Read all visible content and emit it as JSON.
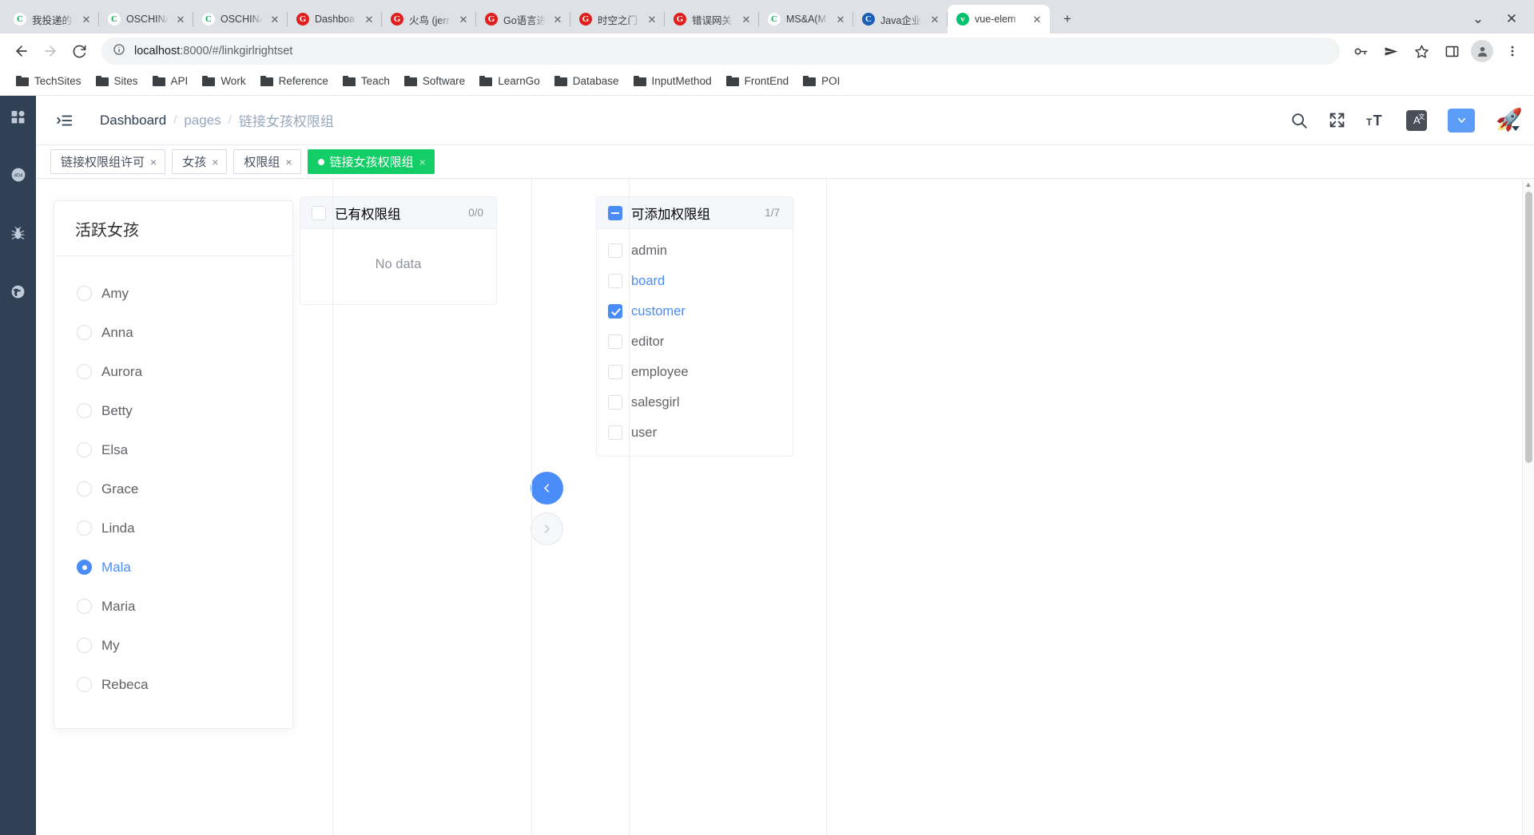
{
  "browser": {
    "tabs": [
      {
        "title": "我投递的",
        "favicon_letter": "C",
        "favicon_color": "#00b04f",
        "favicon_bg": "#ffffff",
        "active": false
      },
      {
        "title": "OSCHINA",
        "favicon_letter": "C",
        "favicon_color": "#00b04f",
        "favicon_bg": "#ffffff",
        "active": false
      },
      {
        "title": "OSCHINA",
        "favicon_letter": "C",
        "favicon_color": "#00b04f",
        "favicon_bg": "#ffffff",
        "active": false
      },
      {
        "title": "Dashboa",
        "favicon_letter": "G",
        "favicon_color": "#ffffff",
        "favicon_bg": "#e01e1e",
        "active": false
      },
      {
        "title": "火鸟 (jerr",
        "favicon_letter": "G",
        "favicon_color": "#ffffff",
        "favicon_bg": "#e01e1e",
        "active": false
      },
      {
        "title": "Go语言进",
        "favicon_letter": "G",
        "favicon_color": "#ffffff",
        "favicon_bg": "#e01e1e",
        "active": false
      },
      {
        "title": "时空之门",
        "favicon_letter": "G",
        "favicon_color": "#ffffff",
        "favicon_bg": "#e01e1e",
        "active": false
      },
      {
        "title": "错误网关",
        "favicon_letter": "G",
        "favicon_color": "#ffffff",
        "favicon_bg": "#e01e1e",
        "active": false
      },
      {
        "title": "MS&A(M",
        "favicon_letter": "C",
        "favicon_color": "#00b04f",
        "favicon_bg": "#ffffff",
        "active": false
      },
      {
        "title": "Java企业",
        "favicon_letter": "C",
        "favicon_color": "#ffffff",
        "favicon_bg": "#1a5fb4",
        "active": false
      },
      {
        "title": "vue-elem",
        "favicon_letter": "v",
        "favicon_color": "#ffffff",
        "favicon_bg": "#00c16e",
        "active": true
      }
    ],
    "new_tab_label": "+",
    "tab_list_label": "⌄",
    "window_close_label": "✕",
    "nav": {
      "back_label": "←",
      "forward_label": "→",
      "reload_label": "⟳"
    },
    "omnibox": {
      "info_icon": "ⓘ",
      "url_host": "localhost",
      "url_rest": ":8000/#/linkgirlrightset"
    },
    "toolbar_icons": [
      "key-icon",
      "send-icon",
      "star-icon",
      "sidepanel-icon",
      "profile-icon",
      "menu-icon"
    ],
    "bookmarks": [
      {
        "label": "TechSites"
      },
      {
        "label": "Sites"
      },
      {
        "label": "API"
      },
      {
        "label": "Work"
      },
      {
        "label": "Reference"
      },
      {
        "label": "Teach"
      },
      {
        "label": "Software"
      },
      {
        "label": "LearnGo"
      },
      {
        "label": "Database"
      },
      {
        "label": "InputMethod"
      },
      {
        "label": "FrontEnd"
      },
      {
        "label": "POI"
      }
    ]
  },
  "app": {
    "sidebar": {
      "items": [
        {
          "icon": "dashboard-grid-icon"
        },
        {
          "icon": "error-404-icon"
        },
        {
          "icon": "bug-icon"
        },
        {
          "icon": "globe-icon"
        }
      ]
    },
    "navbar": {
      "hamburger_icon": "hamburger-indent-icon",
      "breadcrumb": [
        {
          "label": "Dashboard",
          "link": false
        },
        {
          "label": "pages",
          "link": true
        },
        {
          "label": "链接女孩权限组",
          "link": true
        }
      ],
      "separator": "/",
      "search_icon": "search-icon",
      "fullscreen_icon": "fullscreen-icon",
      "fontsize_icon": "font-size-icon",
      "translate_label": "A",
      "translate_sup": "文",
      "blue_button_icon": "chevron-down-icon",
      "avatar_icon": "🚀",
      "avatar_caret": "▾"
    },
    "tags": [
      {
        "label": "链接权限组许可",
        "active": false,
        "close": "×"
      },
      {
        "label": "女孩",
        "active": false,
        "close": "×"
      },
      {
        "label": "权限组",
        "active": false,
        "close": "×"
      },
      {
        "label": "链接女孩权限组",
        "active": true,
        "close": "×"
      }
    ],
    "girls_panel": {
      "title": "活跃女孩",
      "items": [
        {
          "label": "Amy",
          "checked": false
        },
        {
          "label": "Anna",
          "checked": false
        },
        {
          "label": "Aurora",
          "checked": false
        },
        {
          "label": "Betty",
          "checked": false
        },
        {
          "label": "Elsa",
          "checked": false
        },
        {
          "label": "Grace",
          "checked": false
        },
        {
          "label": "Linda",
          "checked": false
        },
        {
          "label": "Mala",
          "checked": true
        },
        {
          "label": "Maria",
          "checked": false
        },
        {
          "label": "My",
          "checked": false
        },
        {
          "label": "Rebeca",
          "checked": false
        }
      ]
    },
    "transfer": {
      "left_panel": {
        "title": "已有权限组",
        "count": "0/0",
        "header_checkbox": "unchecked",
        "empty_text": "No data",
        "items": []
      },
      "right_panel": {
        "title": "可添加权限组",
        "count": "1/7",
        "header_checkbox": "indeterminate",
        "items": [
          {
            "label": "admin",
            "checked": false,
            "highlight": false
          },
          {
            "label": "board",
            "checked": false,
            "highlight": true
          },
          {
            "label": "customer",
            "checked": true,
            "highlight": true
          },
          {
            "label": "editor",
            "checked": false,
            "highlight": false
          },
          {
            "label": "employee",
            "checked": false,
            "highlight": false
          },
          {
            "label": "salesgirl",
            "checked": false,
            "highlight": false
          },
          {
            "label": "user",
            "checked": false,
            "highlight": false
          }
        ]
      },
      "to_left_button": "‹",
      "to_right_button": "›"
    },
    "colors": {
      "sidebar_bg": "#304156",
      "primary": "#4b8df8",
      "tag_active": "#13ce66",
      "link": "#97a8be"
    }
  }
}
